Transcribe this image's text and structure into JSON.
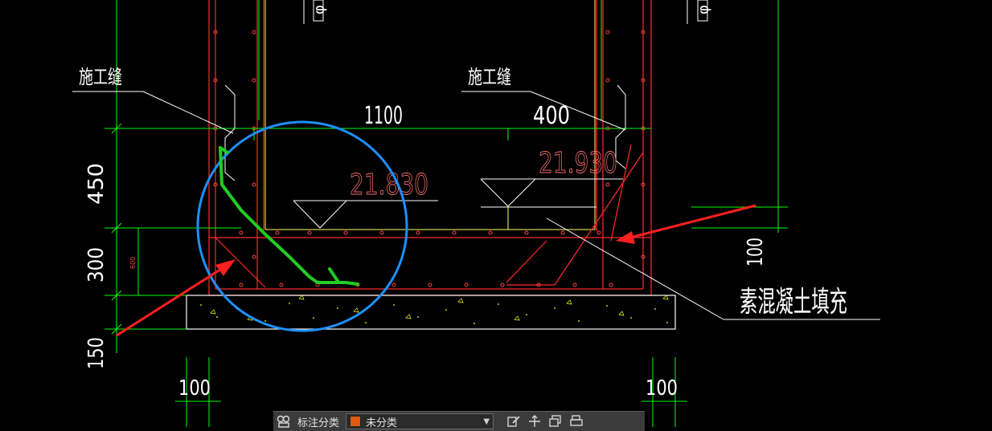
{
  "drawing": {
    "colors": {
      "background": "#000000",
      "structure": "#ff2a2a",
      "dimension": "#00ff00",
      "leader": "#ffffff",
      "elevation": "#ff7070",
      "inner_wall": "#ffff66",
      "markup_circle": "#1e90ff",
      "markup_arrow": "#ff2020",
      "markup_sketch": "#22cc22",
      "concrete_fill": "#ffff00"
    },
    "labels": {
      "joint_left": "施工缝",
      "joint_right": "施工缝",
      "plain_concrete_fill": "素混凝土填充",
      "top_phi_left": "φ",
      "top_phi_right": "φ"
    },
    "dimensions": {
      "width_inner": "1100",
      "width_right": "400",
      "height_upper": "450",
      "height_lower": "300",
      "height_base": "150",
      "height_small": "600",
      "bottom_left": "100",
      "bottom_right": "100",
      "right_side": "100"
    },
    "elevations": {
      "left": "21.830",
      "right": "21.930"
    }
  },
  "toolbar": {
    "icon_left": "annotation-group-icon",
    "label": "标注分类",
    "select_value": "未分类",
    "select_color": "#e05a10",
    "icons": [
      "edit-icon",
      "move-icon",
      "copy-icon",
      "print-icon"
    ]
  }
}
